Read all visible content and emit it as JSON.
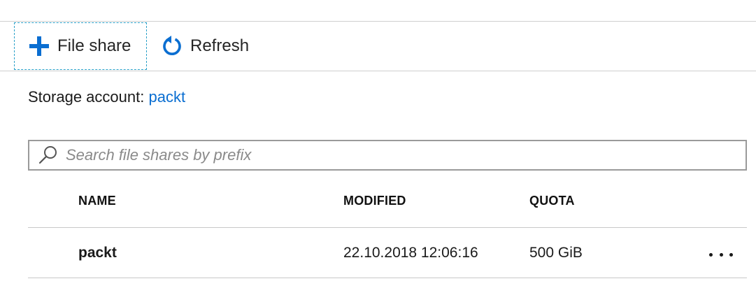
{
  "toolbar": {
    "add_label": "File share",
    "refresh_label": "Refresh",
    "add_icon": "plus-icon",
    "refresh_icon": "refresh-icon",
    "accent_color": "#0a6ed1"
  },
  "storage": {
    "label": "Storage account:",
    "account_name": "packt"
  },
  "search": {
    "placeholder": "Search file shares by prefix",
    "value": ""
  },
  "table": {
    "headers": {
      "name": "NAME",
      "modified": "MODIFIED",
      "quota": "QUOTA"
    },
    "rows": [
      {
        "name": "packt",
        "modified": "22.10.2018 12:06:16",
        "quota": "500 GiB"
      }
    ]
  }
}
